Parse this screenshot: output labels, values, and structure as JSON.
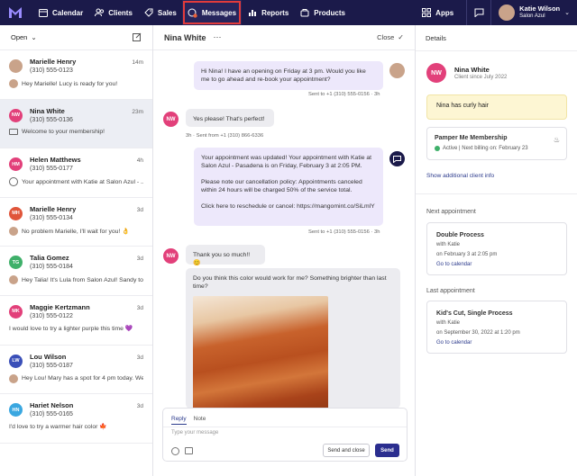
{
  "nav": {
    "items": [
      {
        "label": "Calendar",
        "icon": "calendar-icon"
      },
      {
        "label": "Clients",
        "icon": "clients-icon"
      },
      {
        "label": "Sales",
        "icon": "sales-icon"
      },
      {
        "label": "Messages",
        "icon": "messages-icon"
      },
      {
        "label": "Reports",
        "icon": "reports-icon"
      },
      {
        "label": "Products",
        "icon": "products-icon"
      }
    ],
    "apps_label": "Apps",
    "user_name": "Katie Wilson",
    "user_org": "Salon Azul"
  },
  "conversations": {
    "filter_label": "Open",
    "items": [
      {
        "name": "Marielle Henry",
        "phone": "(310) 555-0123",
        "time": "14m",
        "preview": "Hey Marielle! Lucy is ready for you!",
        "initials": "",
        "avatar_color": "#c9a38a",
        "preview_icon": "staff-avatar-icon"
      },
      {
        "name": "Nina White",
        "phone": "(310) 555-0136",
        "time": "23m",
        "preview": "Welcome to your membership!",
        "initials": "NW",
        "avatar_color": "#e2407a",
        "preview_icon": "mail-icon"
      },
      {
        "name": "Helen Matthews",
        "phone": "(310) 555-0177",
        "time": "4h",
        "preview": "Your appointment with Katie at Salon Azul - ...",
        "initials": "HM",
        "avatar_color": "#e2407a",
        "preview_icon": "chat-icon"
      },
      {
        "name": "Marielle Henry",
        "phone": "(310) 555-0134",
        "time": "3d",
        "preview": "No problem Marielle, I'll wait for you! 👌",
        "initials": "MH",
        "avatar_color": "#e0553a",
        "preview_icon": "staff-avatar-icon"
      },
      {
        "name": "Talia Gomez",
        "phone": "(310) 555-0184",
        "time": "3d",
        "preview": "Hey Talia! It's Lula from Salon Azul! Sandy to...",
        "initials": "TG",
        "avatar_color": "#3fb06a",
        "preview_icon": "staff-avatar-icon"
      },
      {
        "name": "Maggie Kertzmann",
        "phone": "(310) 555-0122",
        "time": "3d",
        "preview": "I would love to try a lighter purple this time 💜",
        "initials": "MK",
        "avatar_color": "#e2407a",
        "preview_icon": ""
      },
      {
        "name": "Lou Wilson",
        "phone": "(310) 555-0187",
        "time": "3d",
        "preview": "Hey Lou! Mary has a spot for 4 pm today. We...",
        "initials": "LW",
        "avatar_color": "#3a4fb8",
        "preview_icon": "staff-avatar-icon"
      },
      {
        "name": "Hariet Nelson",
        "phone": "(310) 555-0165",
        "time": "3d",
        "preview": "I'd love to try a warmer hair color 🍁",
        "initials": "HN",
        "avatar_color": "#3aa7e0",
        "preview_icon": ""
      }
    ]
  },
  "thread": {
    "contact_name": "Nina White",
    "close_label": "Close",
    "messages": {
      "m1": "Hi Nina! I have an opening on Friday at 3 pm. Would you like me to go ahead and re-book your appointment?",
      "m1_meta": "Sent to +1 (310) 555-0156 · 3h",
      "m2": "Yes please! That's perfect!",
      "m2_meta": "3h · Sent from +1 (310) 866-6336",
      "m3_p1": "Your appointment was updated! Your appointment with Katie at Salon Azul - Pasadena is on Friday, February 3 at 2:05 PM.",
      "m3_p2": "Please note our cancellation policy: Appointments canceled within 24 hours will be charged 50% of the service total.",
      "m3_p3": "Click here to reschedule or cancel: https://mangomint.co/SiLmlY",
      "m3_meta": "Sent to +1 (310) 555-0156 · 3h",
      "m4": "Thank you so much!! 😊",
      "m5": "Do you think this color would work for me? Something brighter than last time?"
    },
    "reply": {
      "tab_reply": "Reply",
      "tab_note": "Note",
      "placeholder": "Type your message",
      "send_close_label": "Send and close",
      "send_label": "Send"
    }
  },
  "details": {
    "title": "Details",
    "client_name": "Nina White",
    "client_since": "Client since July 2022",
    "initials": "NW",
    "note": "Nina has curly hair",
    "membership": {
      "name": "Pamper Me Membership",
      "status": "Active | Next billing on: February 23"
    },
    "show_info_label": "Show additional client info",
    "next_appt_heading": "Next appointment",
    "next_appt": {
      "service": "Double Process",
      "with": "with Katie",
      "date": "on February 3 at 2:05 pm",
      "link": "Go to calendar"
    },
    "last_appt_heading": "Last appointment",
    "last_appt": {
      "service": "Kid's Cut, Single Process",
      "with": "with Katie",
      "date": "on September 30, 2022 at 1:20 pm",
      "link": "Go to calendar"
    }
  },
  "colors": {
    "topbar": "#1b1a4a",
    "accent": "#2b2e8f",
    "highlight": "#e23b3b",
    "note_bg": "#fdf6d3"
  }
}
